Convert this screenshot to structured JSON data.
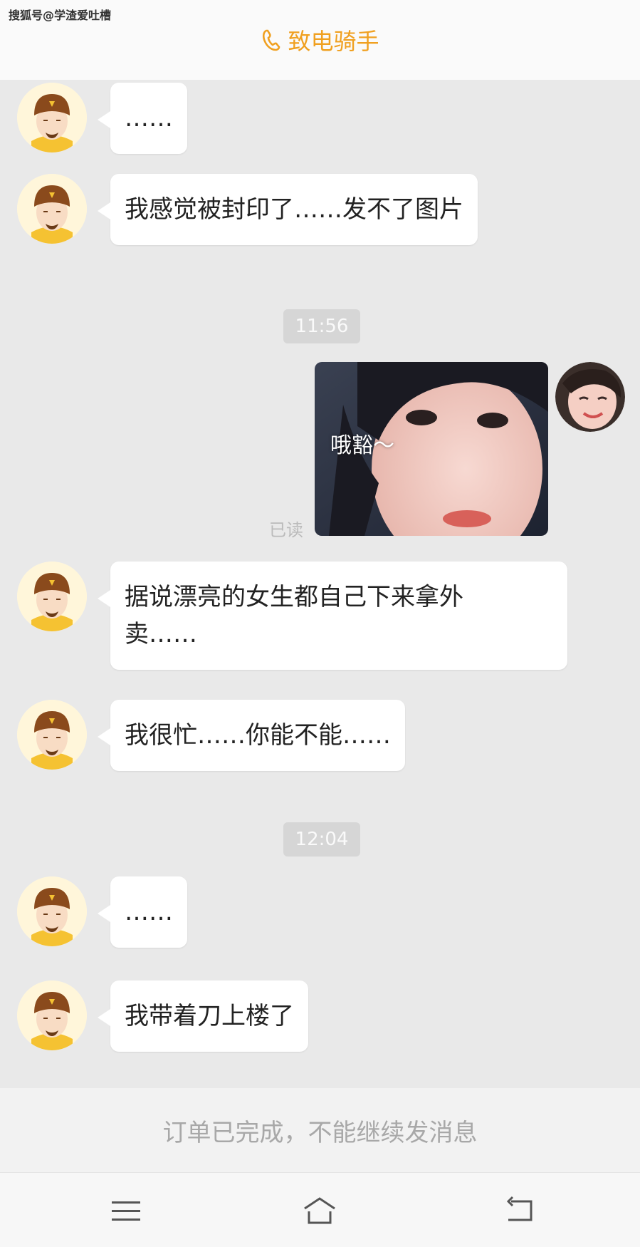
{
  "watermark": "搜狐号@学渣爱吐槽",
  "header": {
    "title": "致电骑手",
    "icon": "phone-icon",
    "accent_color": "#f0a020"
  },
  "messages": [
    {
      "sender": "rider",
      "text": "……"
    },
    {
      "sender": "rider",
      "text": "我感觉被封印了……发不了图片"
    },
    {
      "type": "timestamp",
      "text": "11:56"
    },
    {
      "sender": "self",
      "type": "image",
      "caption": "哦豁～",
      "status": "已读"
    },
    {
      "sender": "rider",
      "line1": "据说漂亮的女生都自己下来拿外",
      "line2": "卖……"
    },
    {
      "sender": "rider",
      "text": "我很忙……你能不能……"
    },
    {
      "type": "timestamp",
      "text": "12:04"
    },
    {
      "sender": "rider",
      "text": "……"
    },
    {
      "sender": "rider",
      "text": "我带着刀上楼了"
    }
  ],
  "footer": {
    "notice": "订单已完成，不能继续发消息"
  },
  "navbar": {
    "icons": [
      "menu-icon",
      "home-icon",
      "back-icon"
    ]
  }
}
